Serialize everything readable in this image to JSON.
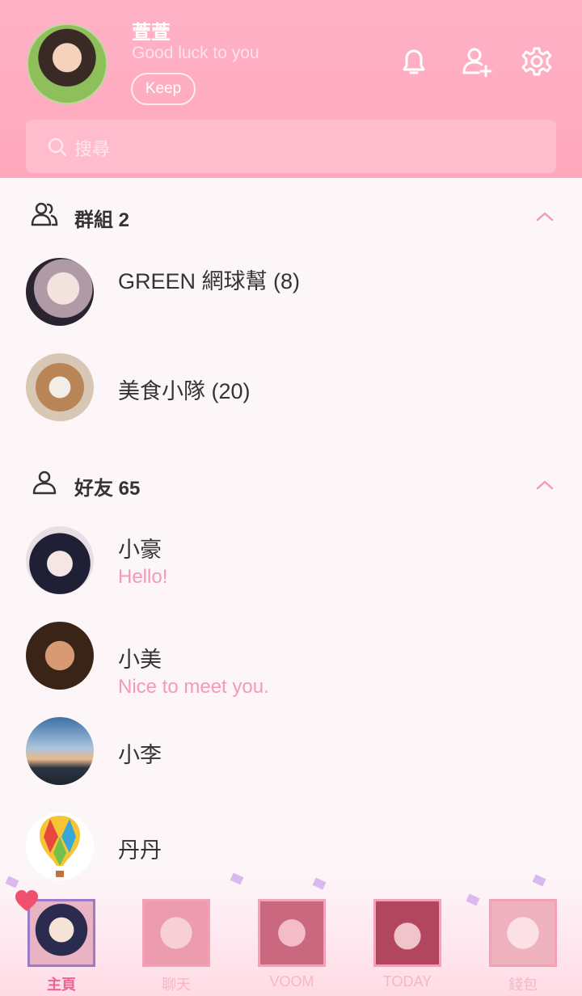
{
  "profile": {
    "name": "萱萱",
    "status": "Good luck to you",
    "keep_label": "Keep"
  },
  "header_icons": [
    "bell-icon",
    "add-friend-icon",
    "settings-icon"
  ],
  "search": {
    "placeholder": "搜尋"
  },
  "groups": {
    "title": "群組 2",
    "items": [
      {
        "name": "GREEN 網球幫 (8)"
      },
      {
        "name": "美食小隊 (20)"
      }
    ]
  },
  "friends": {
    "title": "好友 65",
    "items": [
      {
        "name": "小豪",
        "status": "Hello!"
      },
      {
        "name": "小美",
        "status": "Nice to meet you."
      },
      {
        "name": "小李",
        "status": ""
      },
      {
        "name": "丹丹",
        "status": ""
      }
    ]
  },
  "tabs": [
    {
      "label": "主頁",
      "active": true
    },
    {
      "label": "聊天",
      "active": false
    },
    {
      "label": "VOOM",
      "active": false
    },
    {
      "label": "TODAY",
      "active": false
    },
    {
      "label": "錢包",
      "active": false
    }
  ],
  "colors": {
    "header": "#ffa8bd",
    "accent": "#f49ab4",
    "active_tab": "#f06292"
  }
}
